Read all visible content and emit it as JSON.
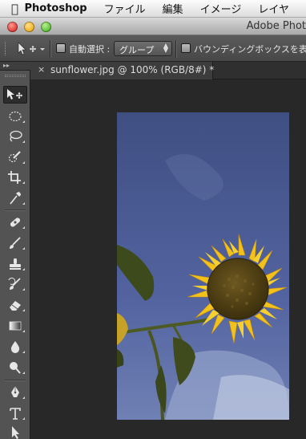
{
  "menubar": {
    "app_name": "Photoshop",
    "items": [
      "ファイル",
      "編集",
      "イメージ",
      "レイヤ"
    ]
  },
  "window": {
    "title": "Adobe Phot"
  },
  "options_bar": {
    "auto_select_label": "自動選択 :",
    "auto_select_checked": false,
    "auto_select_target": "グループ",
    "bounding_box_label": "バウンディングボックスを表",
    "bounding_box_checked": false
  },
  "document_tab": {
    "label": "sunflower.jpg @ 100% (RGB/8#) *",
    "close_glyph": "×"
  },
  "tools_panel": {
    "collapse_glyph": "▸▸",
    "tools": [
      {
        "icon": "move-icon",
        "glyph": "▶✥",
        "active": true
      },
      {
        "icon": "elliptical-marquee-icon",
        "glyph": "◌"
      },
      {
        "icon": "lasso-icon",
        "glyph": "ϱ"
      },
      {
        "icon": "quick-selection-icon",
        "glyph": "✎"
      },
      {
        "icon": "crop-icon",
        "glyph": "⌗"
      },
      {
        "icon": "eyedropper-icon",
        "glyph": "⁄"
      },
      {
        "icon": "spot-healing-brush-icon",
        "glyph": "✚"
      },
      {
        "icon": "brush-icon",
        "glyph": "✑"
      },
      {
        "icon": "clone-stamp-icon",
        "glyph": "⊥"
      },
      {
        "icon": "history-brush-icon",
        "glyph": "✐"
      },
      {
        "icon": "eraser-icon",
        "glyph": "▱"
      },
      {
        "icon": "gradient-icon",
        "glyph": "▭"
      },
      {
        "icon": "blur-icon",
        "glyph": "●"
      },
      {
        "icon": "dodge-icon",
        "glyph": "●"
      },
      {
        "icon": "pen-icon",
        "glyph": "✒"
      },
      {
        "icon": "type-icon",
        "glyph": "T"
      },
      {
        "icon": "path-selection-icon",
        "glyph": "▶"
      }
    ]
  },
  "colors": {
    "sky": "#4a5a8b",
    "petal": "#f3c21a",
    "center": "#4e3e14",
    "leaf": "#3f4a1e"
  }
}
